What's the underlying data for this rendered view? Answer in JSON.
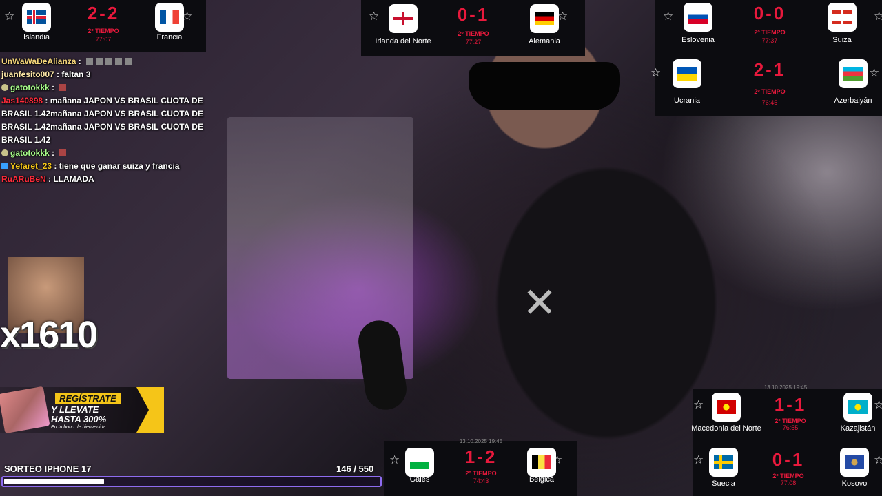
{
  "scoreboards": [
    {
      "home": "Islandia",
      "away": "Francia",
      "score": "2-2",
      "period": "2º TIEMPO",
      "clock": "77:07",
      "home_flag": "iceland-flag-icon",
      "away_flag": "france-flag-icon"
    },
    {
      "home": "Irlanda del Norte",
      "away": "Alemania",
      "score": "0-1",
      "period": "2º TIEMPO",
      "clock": "77:27",
      "home_flag": "northern-ireland-flag-icon",
      "away_flag": "germany-flag-icon"
    },
    {
      "home": "Eslovenia",
      "away": "Suiza",
      "score": "0-0",
      "period": "2º TIEMPO",
      "clock": "77:37",
      "home_flag": "slovenia-flag-icon",
      "away_flag": "switzerland-flag-icon"
    },
    {
      "home": "Ucrania",
      "away": "Azerbaiyán",
      "score": "2-1",
      "period": "2º TIEMPO",
      "clock": "76:45",
      "home_flag": "ukraine-flag-icon",
      "away_flag": "azerbaijan-flag-icon"
    },
    {
      "home": "Macedonia del Norte",
      "away": "Kazajistán",
      "score": "1-1",
      "period": "2º TIEMPO",
      "clock": "76:55",
      "home_flag": "north-macedonia-flag-icon",
      "away_flag": "kazakhstan-flag-icon"
    },
    {
      "home": "Suecia",
      "away": "Kosovo",
      "score": "0-1",
      "period": "2º TIEMPO",
      "clock": "77:08",
      "home_flag": "sweden-flag-icon",
      "away_flag": "kosovo-flag-icon"
    },
    {
      "home": "Gales",
      "away": "Bélgica",
      "score": "1-2",
      "period": "2º TIEMPO",
      "clock": "74:43",
      "home_flag": "wales-flag-icon",
      "away_flag": "belgium-flag-icon"
    }
  ],
  "ticker_text": "13.10.2025 19:45",
  "chat": [
    {
      "user": "UnWaWaDeAlianza",
      "color": "#f5d67a",
      "message": "",
      "emotes": 5,
      "badge": false
    },
    {
      "user": "juanfesito007",
      "color": "#ffe9a8",
      "message": "faltan 3",
      "emotes": 0,
      "badge": false
    },
    {
      "user": "gatotokkk",
      "color": "#a8ff8a",
      "message": "",
      "emotes": 1,
      "badge": true
    },
    {
      "user": "Jas140898",
      "color": "#ff2a3a",
      "message": "mañana JAPON VS BRASIL CUOTA DE BRASIL 1.42mañana JAPON VS BRASIL CUOTA DE BRASIL 1.42mañana JAPON VS BRASIL CUOTA DE BRASIL 1.42",
      "emotes": 0,
      "badge": false
    },
    {
      "user": "gatotokkk",
      "color": "#a8ff8a",
      "message": "",
      "emotes": 1,
      "badge": true
    },
    {
      "user": "Yefaret_23",
      "color": "#f5c518",
      "message": "tiene que ganar suiza y francia",
      "emotes": 0,
      "badge": true
    },
    {
      "user": "RuARuBeN",
      "color": "#ff2a3a",
      "message": "LLAMADA",
      "emotes": 0,
      "badge": false
    }
  ],
  "emote_counter": "x1610",
  "promo": {
    "line1": "REGÍSTRATE",
    "line2": "Y LLEVATE",
    "line3": "HASTA 300%",
    "line4": "En tu bono de bienvenida"
  },
  "giveaway": {
    "title": "SORTEO IPHONE 17",
    "current": "146",
    "separator": " / ",
    "goal": "550",
    "progress": 0.265
  },
  "icons": {
    "favorite": "☆"
  }
}
